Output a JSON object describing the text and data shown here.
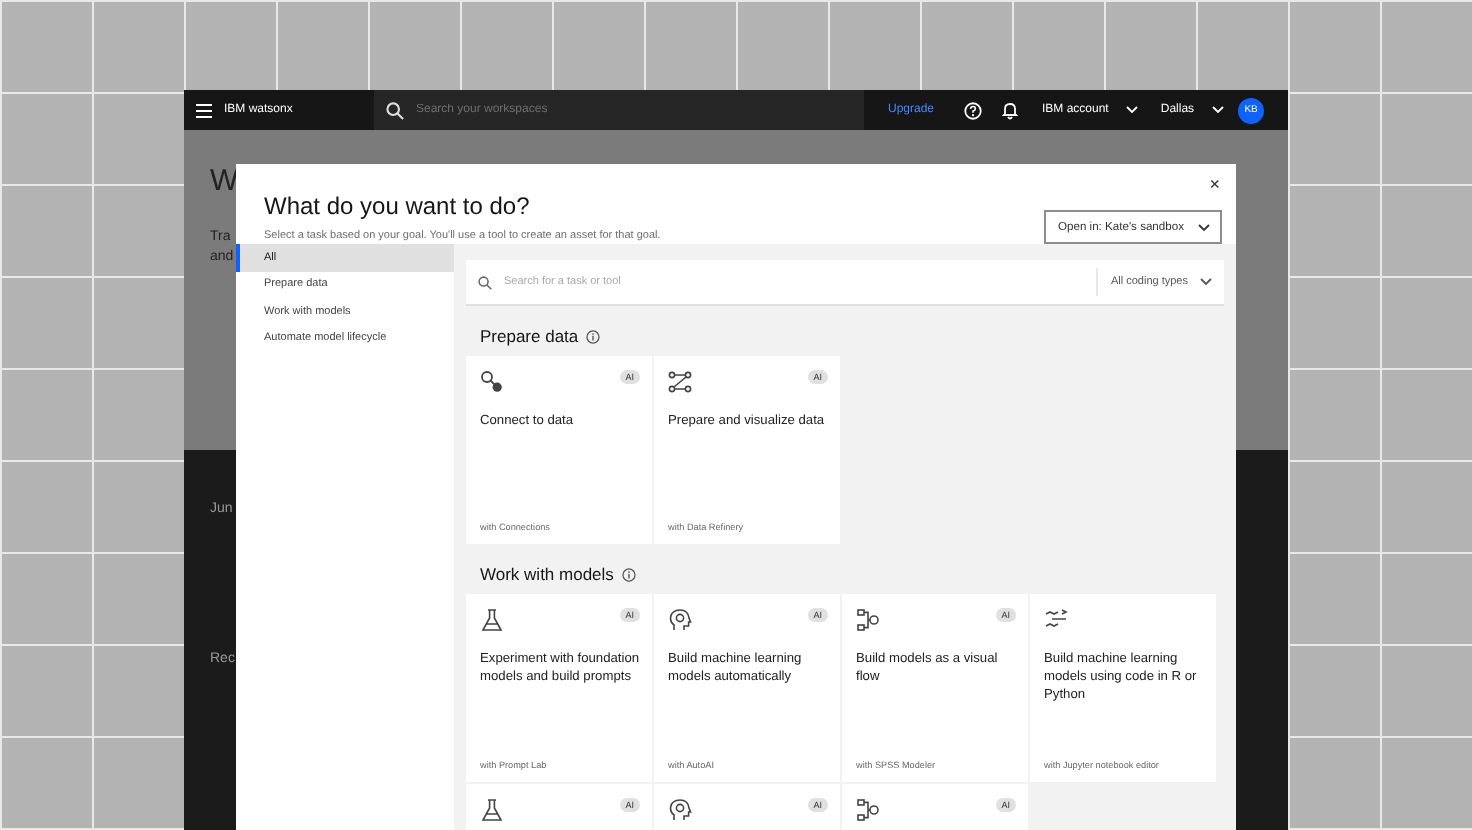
{
  "topbar": {
    "brand": "IBM watsonx",
    "search_placeholder": "Search your workspaces",
    "upgrade": "Upgrade",
    "account": "IBM account",
    "region": "Dallas",
    "avatar": "KB"
  },
  "background_page": {
    "heading": "W",
    "lines": [
      "Tra",
      "and"
    ],
    "section_1": "Jun",
    "section_2": "Rec"
  },
  "modal": {
    "title": "What do you want to do?",
    "subtitle": "Select a task based on your goal. You'll use a tool to create an asset for that goal.",
    "close": "×",
    "open_in": "Open in: Kate's sandbox",
    "nav": [
      {
        "label": "All",
        "selected": true
      },
      {
        "label": "Prepare data",
        "selected": false
      },
      {
        "label": "Work with models",
        "selected": false
      },
      {
        "label": "Automate model lifecycle",
        "selected": false
      }
    ],
    "search_placeholder": "Search for a task or tool",
    "filter": "All coding types",
    "sections": [
      {
        "title": "Prepare data",
        "cards": [
          {
            "kind": "connect",
            "badge": "AI",
            "title": "Connect to data",
            "tool": "with Connections"
          },
          {
            "kind": "flow",
            "badge": "AI",
            "title": "Prepare and visualize data",
            "tool": "with Data Refinery"
          }
        ]
      },
      {
        "title": "Work with models",
        "cards": [
          {
            "kind": "flask",
            "badge": "AI",
            "title": "Experiment with foundation models and build prompts",
            "tool": "with Prompt Lab"
          },
          {
            "kind": "head",
            "badge": "AI",
            "title": "Build machine learning models automatically",
            "tool": "with AutoAI"
          },
          {
            "kind": "nodes",
            "badge": "AI",
            "title": "Build models as a visual flow",
            "tool": "with SPSS Modeler"
          },
          {
            "kind": "code",
            "title": "Build machine learning models using code in R or Python",
            "tool": "with Jupyter notebook editor"
          },
          {
            "kind": "flask",
            "badge": "AI"
          },
          {
            "kind": "head",
            "badge": "AI"
          },
          {
            "kind": "nodes",
            "badge": "AI"
          }
        ]
      }
    ]
  }
}
